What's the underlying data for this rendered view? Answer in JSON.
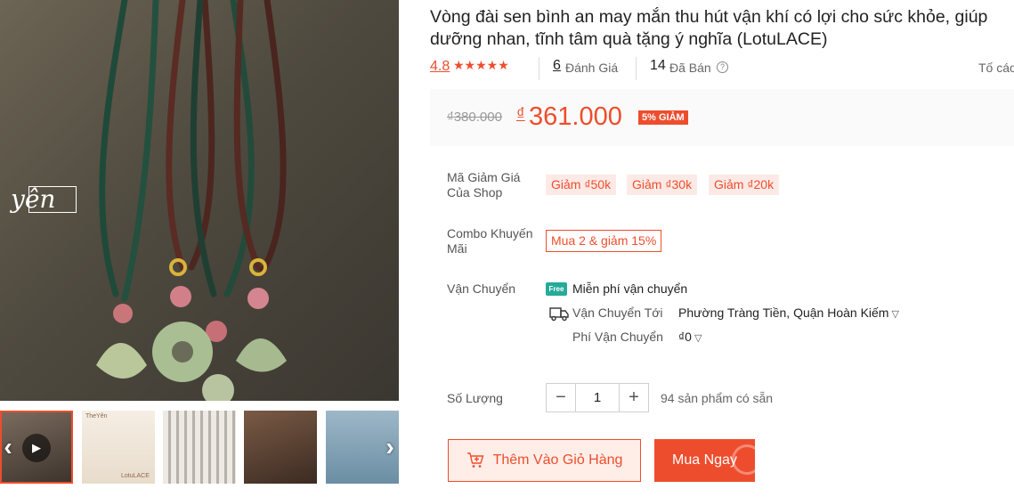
{
  "gallery": {
    "brand_logo_text": "yên",
    "thumb_tags": [
      "TheYên",
      "LotuLACE"
    ],
    "video_icon": "play-icon",
    "prev_icon": "chevron-left-icon",
    "next_icon": "chevron-right-icon"
  },
  "product": {
    "title": "Vòng đài sen bình an may mắn thu hút vận khí có lợi cho sức khỏe, giúp dưỡng nhan, tĩnh tâm quà tặng ý nghĩa (LotuLACE)",
    "rating": "4.8",
    "stars": "★★★★★",
    "reviews_count": "6",
    "reviews_label": "Đánh Giá",
    "sold_count": "14",
    "sold_label": "Đã Bán",
    "report_text": "Tố cáo"
  },
  "price": {
    "original": "₫380.000",
    "currency_symbol": "₫",
    "current": "361.000",
    "discount_badge": "5% GIẢM"
  },
  "vouchers": {
    "label": "Mã Giảm Giá Của Shop",
    "items": [
      "Giảm ₫50k",
      "Giảm ₫30k",
      "Giảm ₫20k"
    ]
  },
  "combo": {
    "label": "Combo Khuyến Mãi",
    "offer": "Mua 2 & giảm 15%"
  },
  "shipping": {
    "label": "Vận Chuyển",
    "free_badge": "Free",
    "free_text": "Miễn phí vận chuyển",
    "to_label": "Vận Chuyển Tới",
    "to_value": "Phường Tràng Tiền, Quận Hoàn Kiếm",
    "fee_label": "Phí Vận Chuyển",
    "fee_value": "₫0"
  },
  "quantity": {
    "label": "Số Lượng",
    "minus": "−",
    "value": "1",
    "plus": "+",
    "stock": "94 sản phẩm có sẵn"
  },
  "actions": {
    "add_to_cart": "Thêm Vào Giỏ Hàng",
    "buy_now": "Mua Ngay"
  },
  "colors": {
    "accent": "#ee4d2d",
    "accent_light": "#ffeee8",
    "free_ship": "#26aa99"
  }
}
